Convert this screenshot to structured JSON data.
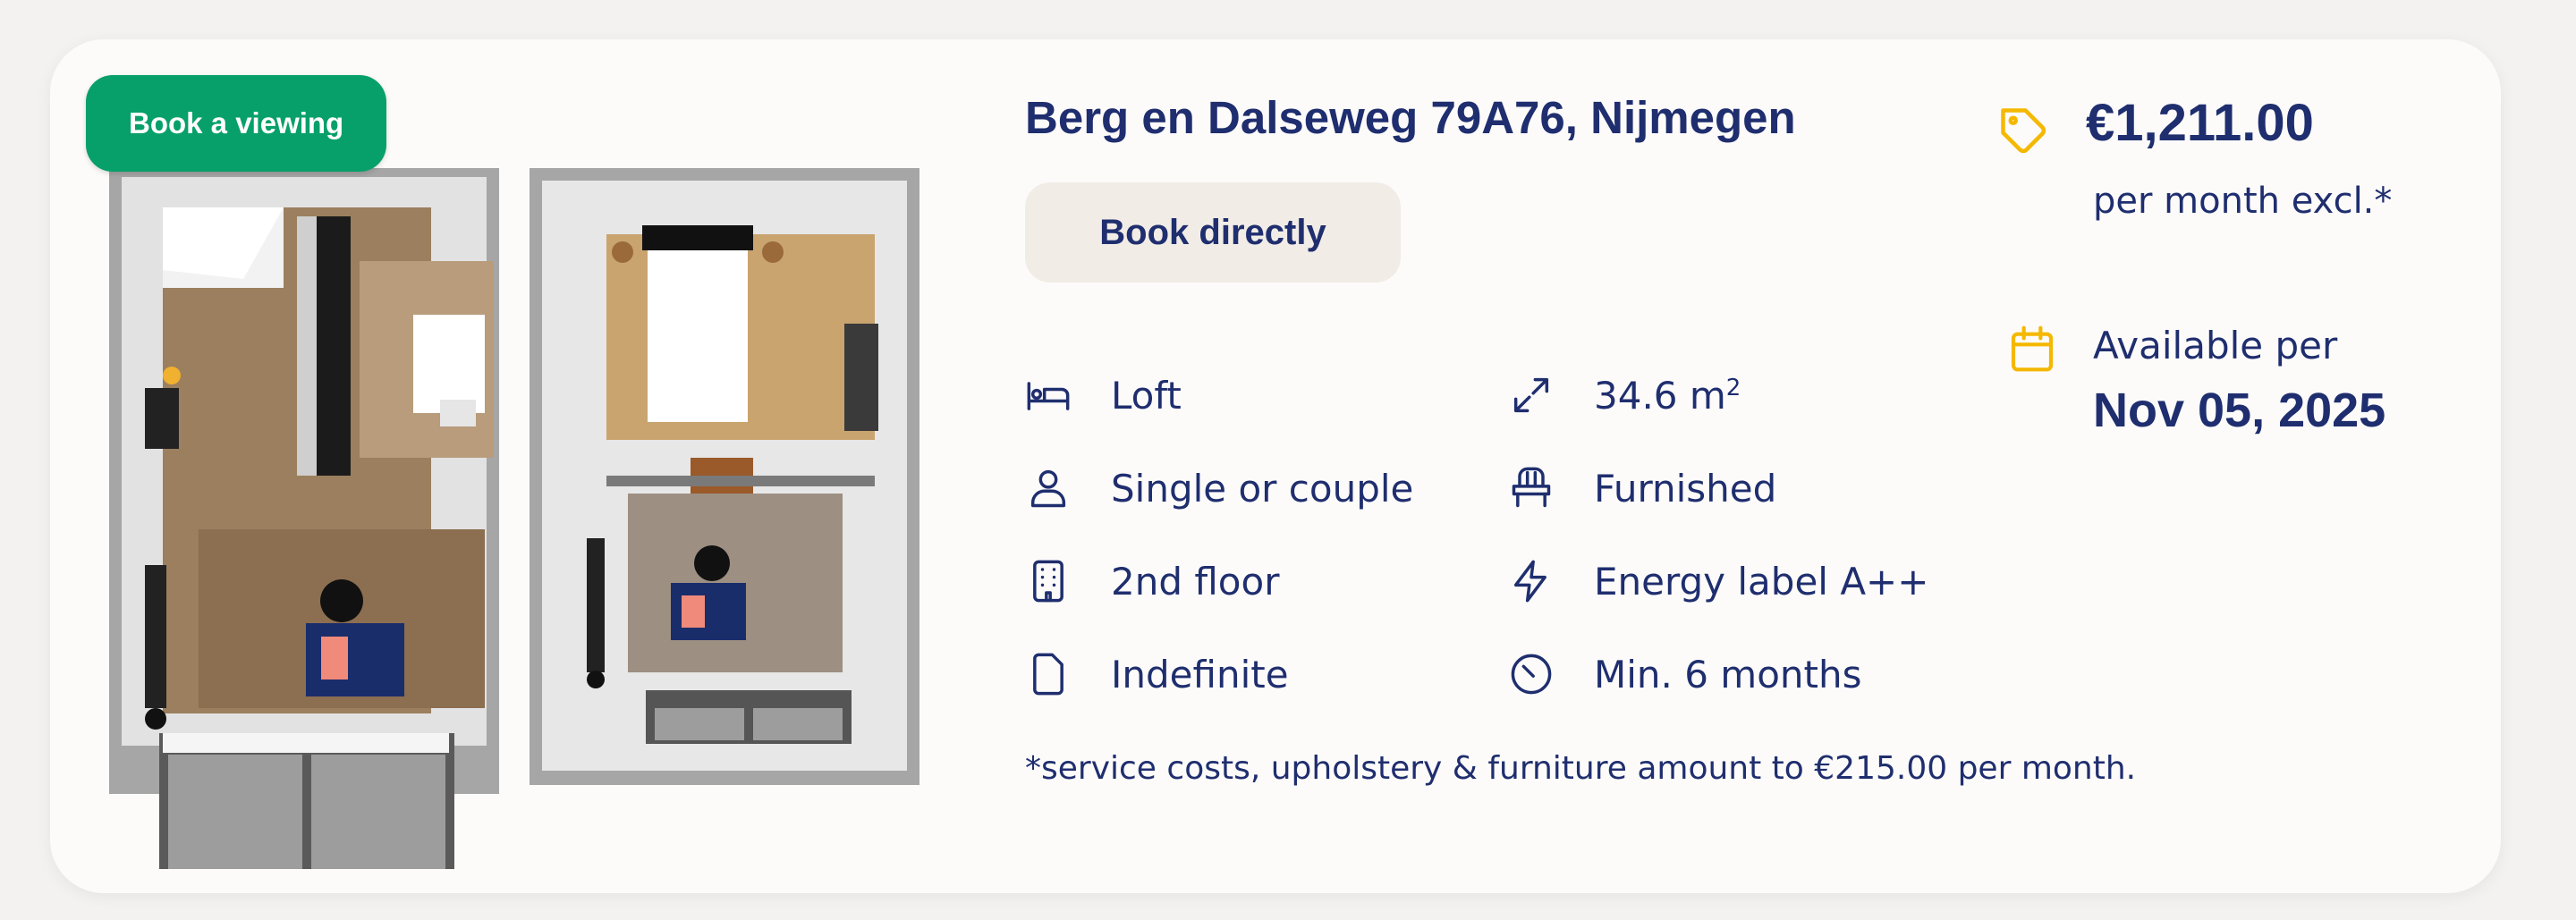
{
  "listing": {
    "title": "Berg en Dalseweg 79A76, Nijmegen",
    "book_viewing_label": "Book a viewing",
    "book_directly_label": "Book directly",
    "floorplan_icon": "floorplan-image"
  },
  "features": {
    "type": {
      "label": "Loft",
      "icon": "bed-icon"
    },
    "size": {
      "value": "34.6 m",
      "unit_sup": "2",
      "icon": "expand-arrows-icon"
    },
    "occupancy": {
      "label": "Single or couple",
      "icon": "person-icon"
    },
    "furnishing": {
      "label": "Furnished",
      "icon": "chair-icon"
    },
    "floor": {
      "label": "2nd floor",
      "icon": "building-icon"
    },
    "energy": {
      "label": "Energy label A++",
      "icon": "lightning-icon"
    },
    "contract": {
      "label": "Indefinite",
      "icon": "document-icon"
    },
    "min_stay": {
      "label": "Min. 6 months",
      "icon": "clock-icon"
    }
  },
  "note": "*service costs, upholstery & furniture amount to €215.00 per month.",
  "price": {
    "amount": "€1,211.00",
    "period": "per month excl.*",
    "icon": "price-tag-icon"
  },
  "availability": {
    "label": "Available per",
    "date": "Nov 05, 2025",
    "icon": "calendar-icon"
  },
  "colors": {
    "accent_green": "#07a06a",
    "navy_text": "#1f2e6e",
    "icon_yellow": "#f5b800",
    "button_beige": "#f1ece6",
    "card_bg": "#fcfbfa"
  }
}
